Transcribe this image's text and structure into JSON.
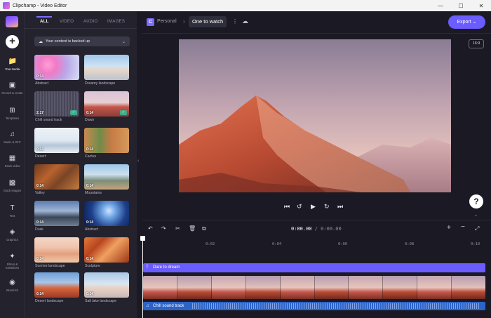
{
  "window": {
    "title": "Clipchamp - Video Editor"
  },
  "rail": {
    "items": [
      {
        "label": "Your media",
        "icon": "folder-icon"
      },
      {
        "label": "Record & create",
        "icon": "camera-icon"
      },
      {
        "label": "Templates",
        "icon": "grid-icon"
      },
      {
        "label": "Music & SFX",
        "icon": "music-icon"
      },
      {
        "label": "Stock video",
        "icon": "film-icon"
      },
      {
        "label": "Stock images",
        "icon": "image-icon"
      },
      {
        "label": "Text",
        "icon": "text-icon"
      },
      {
        "label": "Graphics",
        "icon": "shapes-icon"
      },
      {
        "label": "Filters & transitions",
        "icon": "wand-icon"
      },
      {
        "label": "Brand kit",
        "icon": "brand-icon"
      }
    ]
  },
  "media": {
    "tabs": [
      "ALL",
      "VIDEO",
      "AUDIO",
      "IMAGES"
    ],
    "backup_label": "Your content is backed up",
    "items": [
      {
        "caption": "Abstract",
        "duration": "0:14",
        "checked": false
      },
      {
        "caption": "Dreamy landscape",
        "duration": "",
        "checked": false
      },
      {
        "caption": "Chill sound track",
        "duration": "2:17",
        "checked": true
      },
      {
        "caption": "Dawn",
        "duration": "0:14",
        "checked": true
      },
      {
        "caption": "Desert",
        "duration": "0:14",
        "checked": false
      },
      {
        "caption": "Cactus",
        "duration": "0:14",
        "checked": false
      },
      {
        "caption": "Valley",
        "duration": "0:14",
        "checked": false
      },
      {
        "caption": "Mountains",
        "duration": "0:14",
        "checked": false
      },
      {
        "caption": "Dusk",
        "duration": "0:14",
        "checked": false
      },
      {
        "caption": "Abstract",
        "duration": "0:14",
        "checked": false
      },
      {
        "caption": "Sunrise landscape",
        "duration": "0:14",
        "checked": false
      },
      {
        "caption": "Sculpture",
        "duration": "0:14",
        "checked": false
      },
      {
        "caption": "Desert landscape",
        "duration": "0:14",
        "checked": false
      },
      {
        "caption": "Salt lake landscape",
        "duration": "0:14",
        "checked": false
      }
    ]
  },
  "project": {
    "workspace_initial": "C",
    "workspace_name": "Personal",
    "title": "One to watch",
    "export_label": "Export",
    "aspect_ratio": "16:9"
  },
  "timeline": {
    "time_current": "0:00.00",
    "time_separator": "/",
    "time_total": "0:00.00",
    "ruler": [
      "0:02",
      "0:04",
      "0:06",
      "0:08",
      "0:10"
    ],
    "text_track": "Dare to dream",
    "audio_track": "Chill sound track"
  },
  "colors": {
    "accent": "#6b5cff",
    "audio": "#2c63c7",
    "check": "#3fae8c"
  }
}
